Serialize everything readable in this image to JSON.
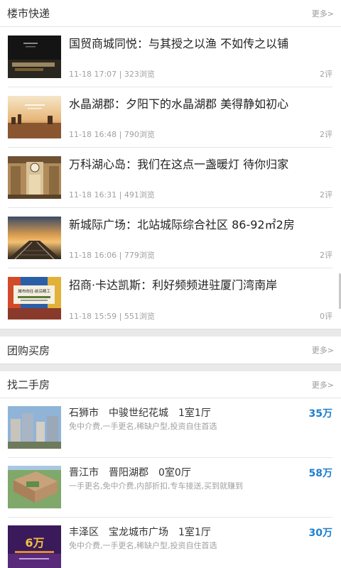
{
  "news_section": {
    "title": "楼市快递",
    "more": "更多>",
    "items": [
      {
        "title": "国贸商城同悦：与其授之以渔 不如传之以铺",
        "time": "11-18 17:07",
        "views": "323浏览",
        "comments": "2评"
      },
      {
        "title": "水晶湖郡：夕阳下的水晶湖郡 美得静如初心",
        "time": "11-18 16:48",
        "views": "790浏览",
        "comments": "2评"
      },
      {
        "title": "万科湖心岛：我们在这点一盏暖灯 待你归家",
        "time": "11-18 16:31",
        "views": "491浏览",
        "comments": "2评"
      },
      {
        "title": "新城际广场：北站城际综合社区 86-92㎡2房",
        "time": "11-18 16:06",
        "views": "779浏览",
        "comments": "2评"
      },
      {
        "title": "招商·卡达凯斯：利好频频进驻厦门湾南岸",
        "time": "11-18 15:59",
        "views": "551浏览",
        "comments": "0评"
      }
    ]
  },
  "group_section": {
    "title": "团购买房",
    "more": "更多>"
  },
  "second_hand_section": {
    "title": "找二手房",
    "more": "更多>",
    "items": [
      {
        "title": "石狮市　中骏世纪花城　1室1厅",
        "desc": "免中介费,一手更名,稀缺户型,投资自住首选",
        "price": "35万"
      },
      {
        "title": "晋江市　晋阳湖郡　0室0厅",
        "desc": "一手更名,免中介费,内部折扣,专车接送,买到就赚到",
        "price": "58万"
      },
      {
        "title": "丰泽区　宝龙城市广场　1室1厅",
        "desc": "免中介费,一手更名,稀缺户型,投资自住首选",
        "price": "30万"
      }
    ]
  },
  "colors": {
    "price": "#1e7fcf",
    "meta": "#a0a0a0",
    "background": "#e9e9e9"
  },
  "thumb_art": {
    "news_5_sign": "城市向往·前沿精工",
    "house_3_sign": "6万"
  }
}
